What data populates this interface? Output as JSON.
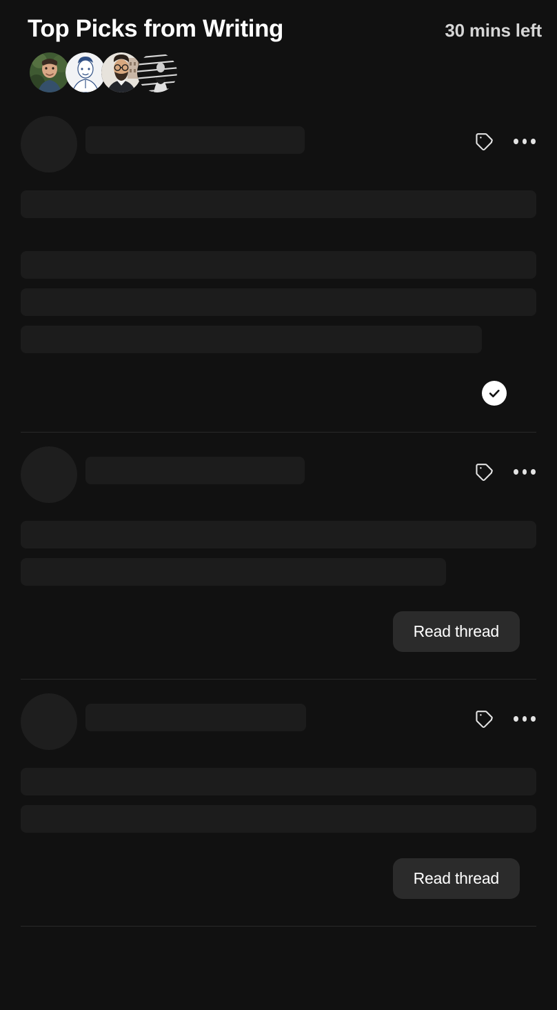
{
  "header": {
    "title": "Top Picks from Writing",
    "time_left": "30 mins left",
    "avatars": [
      {
        "name": "avatar-1",
        "alt": "person outdoors with greenery"
      },
      {
        "name": "avatar-2",
        "alt": "illustrated portrait on white"
      },
      {
        "name": "avatar-3",
        "alt": "bearded man with glasses in suit"
      },
      {
        "name": "avatar-4",
        "alt": "black and white striped photo"
      }
    ]
  },
  "colors": {
    "background": "#111111",
    "skeleton": "#1c1c1c",
    "skeleton_avatar": "#1e1e1e",
    "divider": "#2a2a2a",
    "button_bg": "#2b2b2b",
    "text_primary": "#ffffff",
    "text_secondary": "#d6d6d6",
    "icon": "#e3e3e3",
    "badge_bg": "#ffffff",
    "badge_check": "#111111"
  },
  "feed": {
    "cards": [
      {
        "state": "loading",
        "tag_icon": "tag-icon",
        "more_icon": "more-options-icon",
        "name_skeleton_width": 318,
        "lines": [
          {
            "width_pct": 100,
            "top_gap": 22
          },
          {
            "width_pct": 100,
            "top_gap": 48
          },
          {
            "width_pct": 100,
            "top_gap": 14
          },
          {
            "width_pct": 89.5,
            "top_gap": 14
          }
        ],
        "footer": {
          "type": "check-badge",
          "icon": "check-icon"
        }
      },
      {
        "state": "loading",
        "tag_icon": "tag-icon",
        "more_icon": "more-options-icon",
        "name_skeleton_width": 318,
        "lines": [
          {
            "width_pct": 100,
            "top_gap": 22
          },
          {
            "width_pct": 82.5,
            "top_gap": 14
          }
        ],
        "footer": {
          "type": "button",
          "label": "Read thread"
        }
      },
      {
        "state": "loading",
        "tag_icon": "tag-icon",
        "more_icon": "more-options-icon",
        "name_skeleton_width": 320,
        "lines": [
          {
            "width_pct": 100,
            "top_gap": 22
          },
          {
            "width_pct": 100,
            "top_gap": 14
          }
        ],
        "footer": {
          "type": "button",
          "label": "Read thread"
        }
      }
    ]
  }
}
